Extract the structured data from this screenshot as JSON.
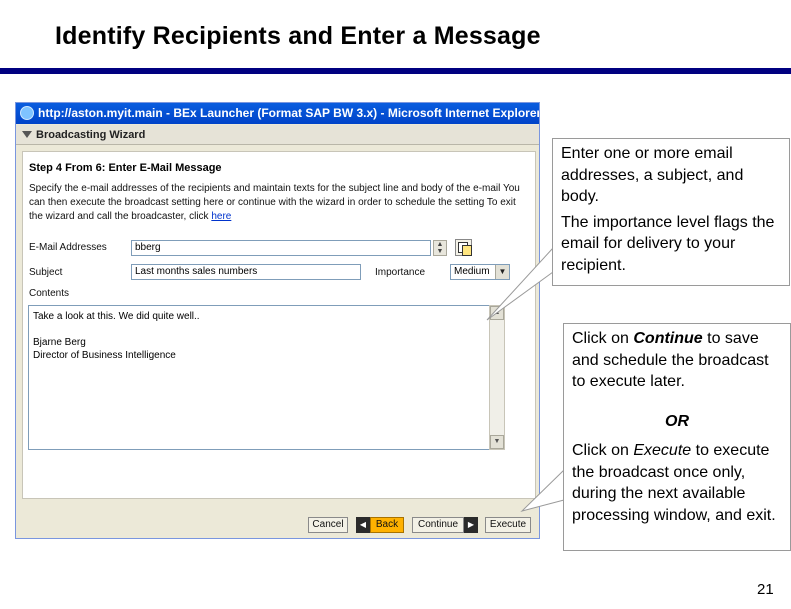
{
  "slide": {
    "title": "Identify Recipients and Enter a Message",
    "page_number": "21"
  },
  "browser": {
    "window_title": "http://aston.myit.main - BEx Launcher (Format SAP BW 3.x) - Microsoft Internet Explorer",
    "wizard_header": "Broadcasting Wizard",
    "step_title": "Step 4 From 6: Enter E-Mail Message",
    "instructions_text": "Specify the e-mail addresses of the recipients and maintain texts for the subject line and body of the e-mail You can then execute the broadcast setting here or continue with the wizard in order to schedule the setting To exit the wizard and call the broadcaster, click",
    "instructions_link": "here",
    "form": {
      "email_label": "E-Mail Addresses",
      "email_value": "bberg",
      "subject_label": "Subject",
      "subject_value": "Last months sales numbers",
      "importance_label": "Importance",
      "importance_value": "Medium",
      "contents_label": "Contents",
      "contents_line1": "Take a look at this. We did quite well..",
      "contents_line2": "Bjarne Berg",
      "contents_line3": "Director of Business Intelligence"
    },
    "buttons": {
      "cancel": "Cancel",
      "back": "Back",
      "continue": "Continue",
      "execute": "Execute"
    }
  },
  "callouts": {
    "first_p1": "Enter one or more email addresses, a subject, and body.",
    "first_p2": "The importance level flags the email for delivery to your recipient.",
    "second_p1_prefix": "Click on ",
    "second_p1_em": "Continue",
    "second_p1_suffix": " to save and schedule the broadcast to execute later.",
    "or": "OR",
    "second_p2_prefix": "Click on ",
    "second_p2_em": "Execute",
    "second_p2_suffix": " to execute the broadcast once only, during the next available processing window, and exit."
  }
}
